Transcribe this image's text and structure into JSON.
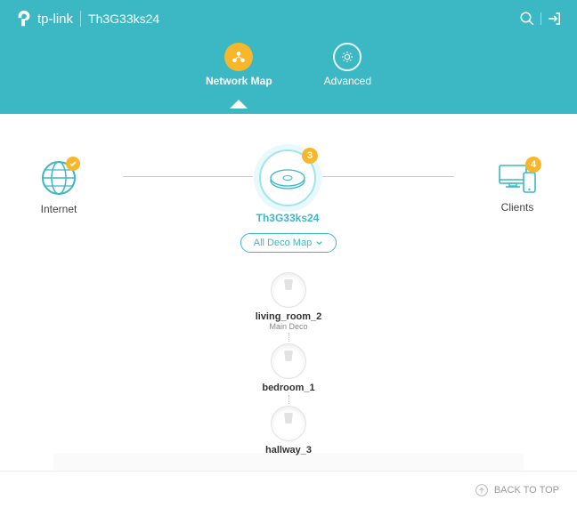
{
  "brand": "tp-link",
  "network_name": "Th3G33ks24",
  "tabs": {
    "network_map": "Network Map",
    "advanced": "Advanced"
  },
  "nodes": {
    "internet": "Internet",
    "main_deco": "Th3G33ks24",
    "main_badge": "3",
    "clients": "Clients",
    "clients_badge": "4"
  },
  "map_button": "All Deco Map",
  "decos": [
    {
      "name": "living_room_2",
      "sub": "Main Deco"
    },
    {
      "name": "bedroom_1",
      "sub": ""
    },
    {
      "name": "hallway_3",
      "sub": ""
    }
  ],
  "footer": {
    "back_to_top": "BACK TO TOP"
  }
}
